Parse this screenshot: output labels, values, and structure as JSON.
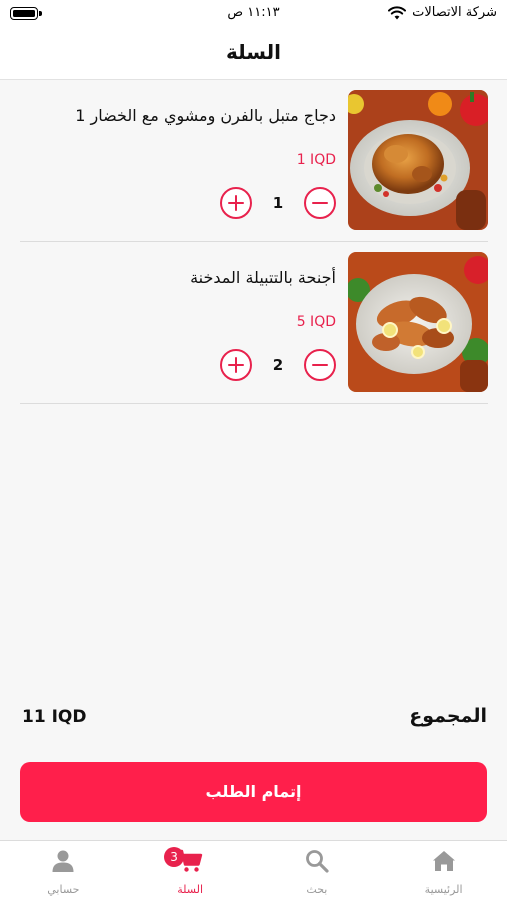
{
  "status_bar": {
    "carrier": "شركة الاتصالات",
    "time": "١١:١٣ ص"
  },
  "header": {
    "title": "السلة"
  },
  "cart": {
    "items": [
      {
        "title": "دجاج متبل بالفرن ومشوي مع الخضار 1",
        "price": "1 IQD",
        "quantity": "1",
        "image": "roasted-chicken-photo"
      },
      {
        "title": "أجنحة بالتتبيلة المدخنة",
        "price": "5 IQD",
        "quantity": "2",
        "image": "smoked-wings-photo"
      }
    ]
  },
  "summary": {
    "total_label": "المجموع",
    "total_value": "11 IQD"
  },
  "checkout": {
    "label": "إتمام الطلب"
  },
  "tabbar": {
    "tabs": [
      {
        "label": "الرئيسية",
        "icon": "home-icon",
        "active": false
      },
      {
        "label": "بحث",
        "icon": "search-icon",
        "active": false
      },
      {
        "label": "السلة",
        "icon": "cart-icon",
        "active": true,
        "badge": "3"
      },
      {
        "label": "حسابي",
        "icon": "person-icon",
        "active": false
      }
    ]
  },
  "colors": {
    "accent": "#e8224d",
    "button": "#ff1f4b",
    "inactive": "#999999",
    "background": "#f7f7f7"
  }
}
